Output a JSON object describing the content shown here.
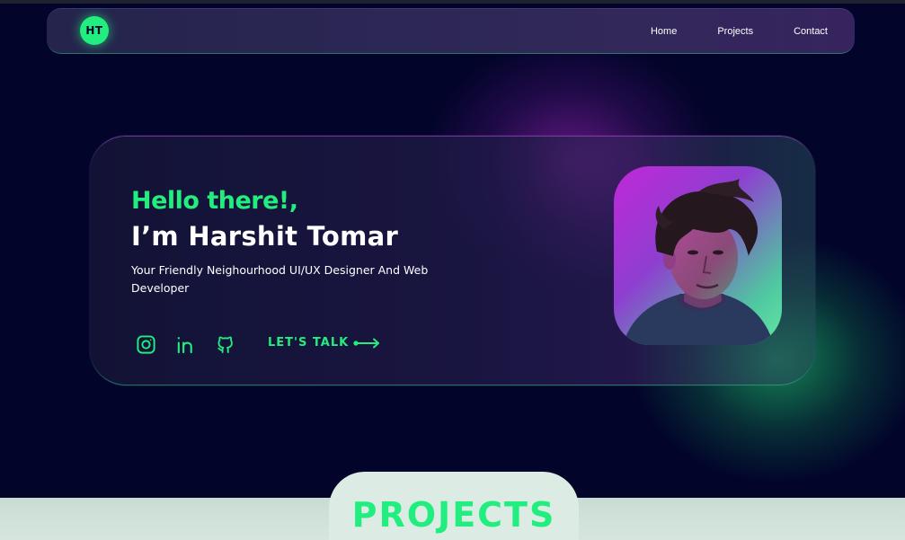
{
  "nav": {
    "logo_text": "HT",
    "links": [
      "Home",
      "Projects",
      "Contact"
    ]
  },
  "hero": {
    "greeting": "Hello there!,",
    "name": "I’m Harshit Tomar",
    "tagline": "Your Friendly Neighourhood UI/UX Designer And Web Developer",
    "socials": [
      "instagram-icon",
      "linkedin-icon",
      "github-icon"
    ],
    "cta_label": "LET'S TALK"
  },
  "sections": {
    "projects_title": "PROJECTS"
  },
  "colors": {
    "accent": "#21ee7e",
    "background": "#02042a",
    "purple_glow": "#b028c8"
  }
}
